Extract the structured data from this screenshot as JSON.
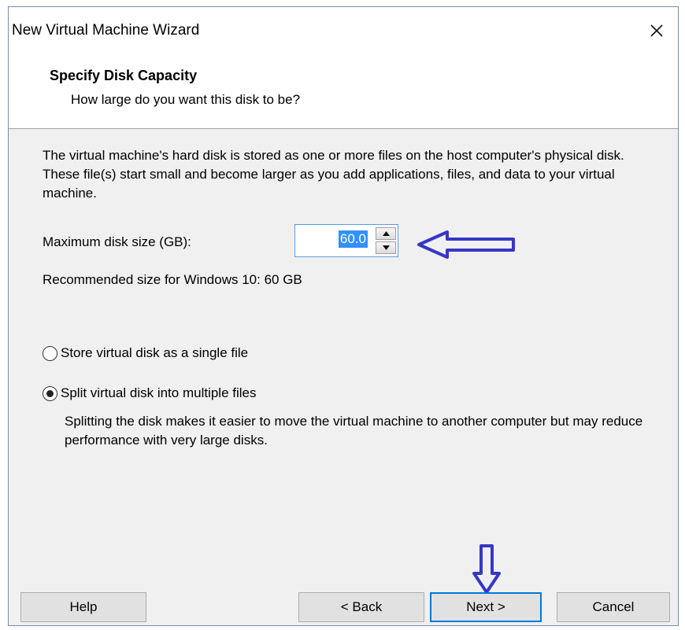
{
  "window": {
    "title": "New Virtual Machine Wizard"
  },
  "header": {
    "title": "Specify Disk Capacity",
    "subtitle": "How large do you want this disk to be?"
  },
  "content": {
    "intro": "The virtual machine's hard disk is stored as one or more files on the host computer's physical disk. These file(s) start small and become larger as you add applications, files, and data to your virtual machine.",
    "disk_size_label": "Maximum disk size (GB):",
    "disk_size_value": "60.0",
    "recommended": "Recommended size for Windows 10: 60 GB",
    "options": [
      {
        "label": "Store virtual disk as a single file",
        "selected": false
      },
      {
        "label": "Split virtual disk into multiple files",
        "selected": true
      }
    ],
    "split_description": "Splitting the disk makes it easier to move the virtual machine to another computer but may reduce performance with very large disks."
  },
  "footer": {
    "help": "Help",
    "back": "< Back",
    "next": "Next >",
    "cancel": "Cancel"
  },
  "icons": {
    "close": "close-icon",
    "spin_up": "arrow-up-icon",
    "spin_down": "arrow-down-icon",
    "annotation_left": "arrow-left-icon",
    "annotation_down": "arrow-down-icon"
  },
  "colors": {
    "annotation": "#3636c8",
    "focus_border": "#0078d7",
    "selection": "#3390ff"
  }
}
